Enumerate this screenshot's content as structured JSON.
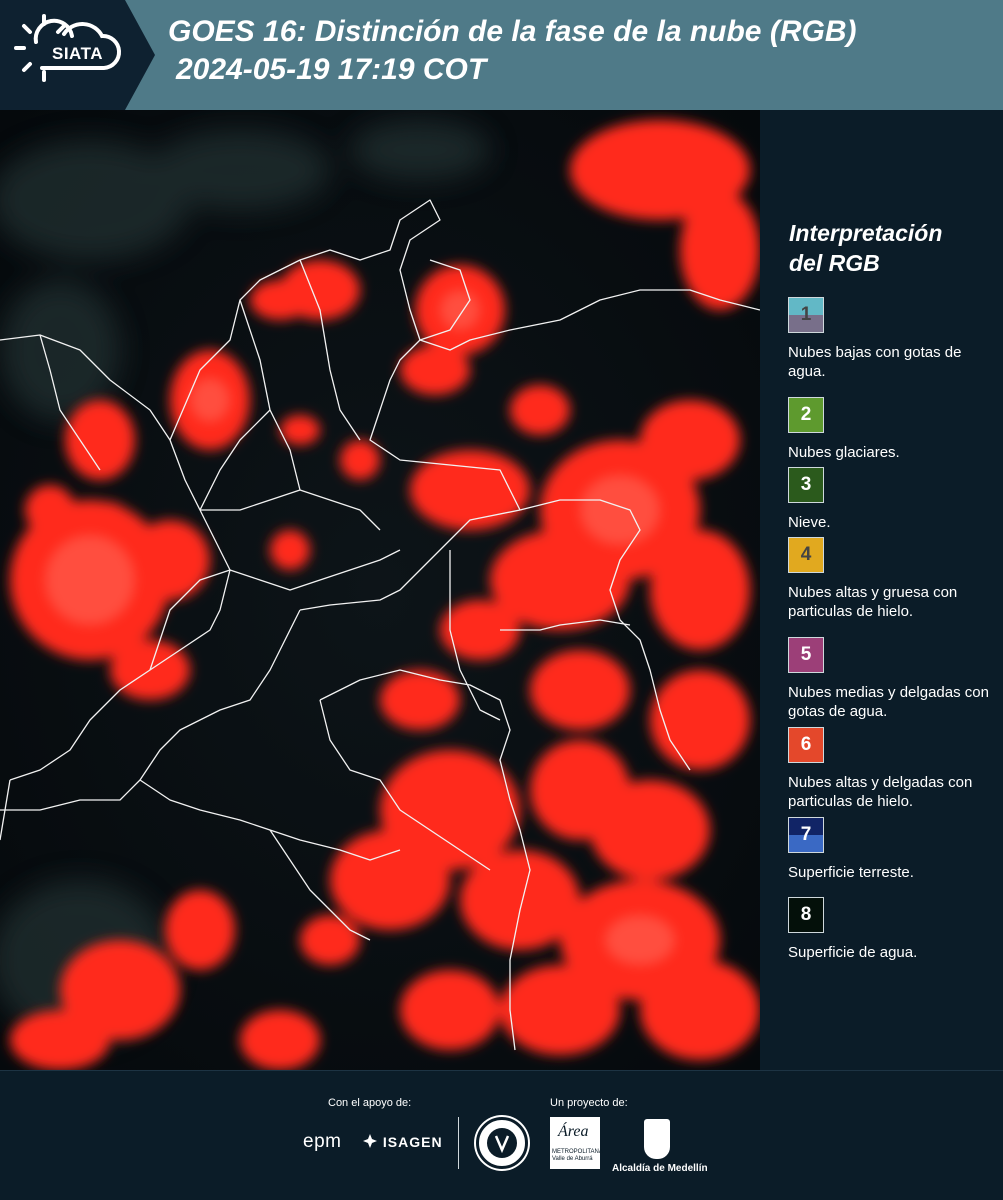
{
  "header": {
    "logo_text": "SIATA",
    "title": "GOES 16: Distinción de la fase de la nube (RGB)",
    "subtitle": "2024-05-19 17:19 COT"
  },
  "legend": {
    "title_line1": "Interpretación",
    "title_line2": "del RGB",
    "items": [
      {
        "num": "1",
        "label": "Nubes bajas con gotas de agua.",
        "color_top": "#62b8c6",
        "color_bottom": "#786f8a",
        "text_color": "#444444"
      },
      {
        "num": "2",
        "label": "Nubes glaciares.",
        "color_top": "#5e9a2e",
        "color_bottom": "#5e9a2e",
        "text_color": "#ffffff"
      },
      {
        "num": "3",
        "label": "Nieve.",
        "color_top": "#2b5a1c",
        "color_bottom": "#2b5a1c",
        "text_color": "#ffffff"
      },
      {
        "num": "4",
        "label": "Nubes altas y gruesa con particulas de hielo.",
        "color_top": "#e1a91f",
        "color_bottom": "#e1a91f",
        "text_color": "#444444"
      },
      {
        "num": "5",
        "label": "Nubes medias y delgadas con gotas de agua.",
        "color_top": "#9c3f78",
        "color_bottom": "#9c3f78",
        "text_color": "#ffffff"
      },
      {
        "num": "6",
        "label": "Nubes altas y delgadas con particulas de hielo.",
        "color_top": "#e4482b",
        "color_bottom": "#e4482b",
        "text_color": "#ffffff"
      },
      {
        "num": "7",
        "label": "Superficie terreste.",
        "color_top": "#112466",
        "color_bottom": "#3a69c4",
        "text_color": "#ffffff"
      },
      {
        "num": "8",
        "label": "Superficie de agua.",
        "color_top": "#04100a",
        "color_bottom": "#04100a",
        "text_color": "#ffffff"
      }
    ]
  },
  "footer": {
    "support_label": "Con el apoyo de:",
    "project_label": "Un proyecto de:",
    "epm": "epm",
    "isagen": "ISAGEN",
    "area_text": "Área",
    "area_sub": "METROPOLITANA Valle de Aburrá",
    "medellin": "Alcaldía de Medellín"
  },
  "colors": {
    "header_bg": "#4f7a88",
    "panel_bg": "#0b1c28",
    "cloud_red": "#ff2a1e"
  },
  "icons": [
    "sun-cloud-logo-icon",
    "isagen-logo-icon",
    "seal-icon",
    "coat-of-arms-icon"
  ]
}
